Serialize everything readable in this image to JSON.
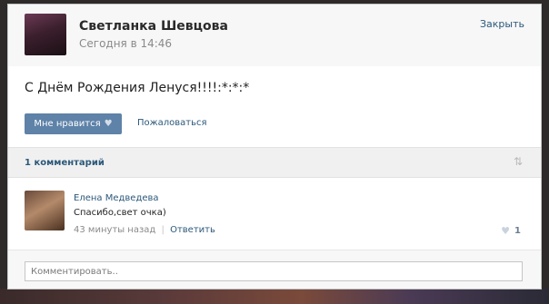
{
  "post": {
    "author": "Светланка Шевцова",
    "time": "Сегодня в 14:46",
    "close_label": "Закрыть",
    "text": "С Днём Рождения Ленуся!!!!:*:*:*",
    "like_label": "Мне нравится",
    "report_label": "Пожаловаться"
  },
  "comments_header": {
    "count_label": "1 комментарий",
    "sort_icon": "⇅"
  },
  "comment": {
    "author": "Елена Медведева",
    "text": "Спасибо,свет очка)",
    "time": "43 минуты назад",
    "separator": "|",
    "reply_label": "Ответить",
    "likes": "1"
  },
  "compose": {
    "placeholder": "Комментировать.."
  },
  "icons": {
    "heart": "♥"
  },
  "colors": {
    "link": "#2b587a",
    "button": "#5e82a8"
  }
}
